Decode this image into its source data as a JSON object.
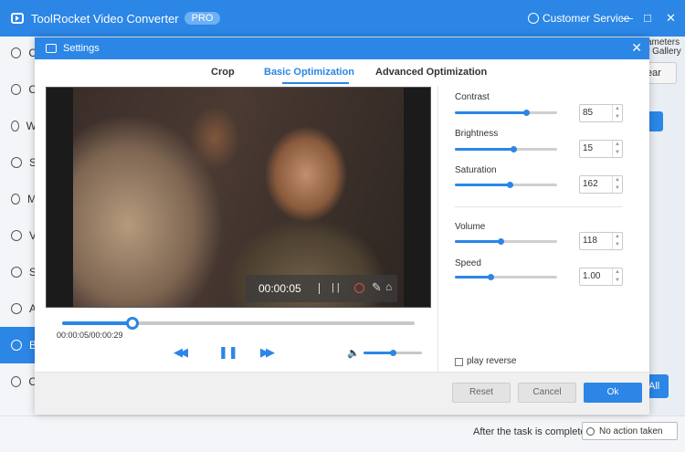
{
  "app": {
    "title": "ToolRocket Video Converter",
    "badge": "PRO",
    "customer_service": "Customer Service",
    "minimize": "—",
    "maximize": "□",
    "close": "✕"
  },
  "sidebar": {
    "items": [
      {
        "initial": "C",
        "icon": "convert-icon"
      },
      {
        "initial": "C",
        "icon": "compress-icon"
      },
      {
        "initial": "W",
        "icon": "watermark-icon"
      },
      {
        "initial": "S",
        "icon": "speed-icon"
      },
      {
        "initial": "M",
        "icon": "merge-icon"
      },
      {
        "initial": "V",
        "icon": "gif-icon"
      },
      {
        "initial": "S",
        "icon": "screen-record-icon"
      },
      {
        "initial": "A",
        "icon": "audio-icon"
      },
      {
        "initial": "B",
        "icon": "film-reel-icon",
        "active": true
      },
      {
        "initial": "C",
        "icon": "crop-icon"
      }
    ]
  },
  "background": {
    "right_line1": "ameters",
    "right_line2": "r Gallery",
    "clear_button": "ear",
    "all_button": "All",
    "after_task_label": "After the task is completed",
    "after_task_value": "No action taken"
  },
  "dialog": {
    "title": "Settings",
    "close": "✕",
    "tabs": [
      {
        "label": "Crop",
        "active": false
      },
      {
        "label": "Basic Optimization",
        "active": true
      },
      {
        "label": "Advanced Optimization",
        "active": false
      }
    ],
    "overlay_time": "00:00:05",
    "overlay_pause": "| |",
    "overlay_pen": "✎",
    "overlay_home": "⌂",
    "playback": {
      "time_text": "00:00:05/00:00:29",
      "progress": 0.2,
      "volume": 0.5,
      "rewind": "◀◀",
      "pause": "❚❚",
      "forward": "▶▶",
      "volume_icon": "🔈"
    },
    "controls": [
      {
        "label": "Contrast",
        "value": "85",
        "fraction": 0.7
      },
      {
        "label": "Brightness",
        "value": "15",
        "fraction": 0.57
      },
      {
        "label": "Saturation",
        "value": "162",
        "fraction": 0.54
      },
      {
        "label": "Volume",
        "value": "118",
        "fraction": 0.45
      },
      {
        "label": "Speed",
        "value": "1.00",
        "fraction": 0.35
      }
    ],
    "play_reverse": "play reverse",
    "buttons": {
      "reset": "Reset",
      "cancel": "Cancel",
      "ok": "Ok"
    }
  },
  "colors": {
    "accent": "#2b86e6",
    "record": "#e04a3a"
  }
}
